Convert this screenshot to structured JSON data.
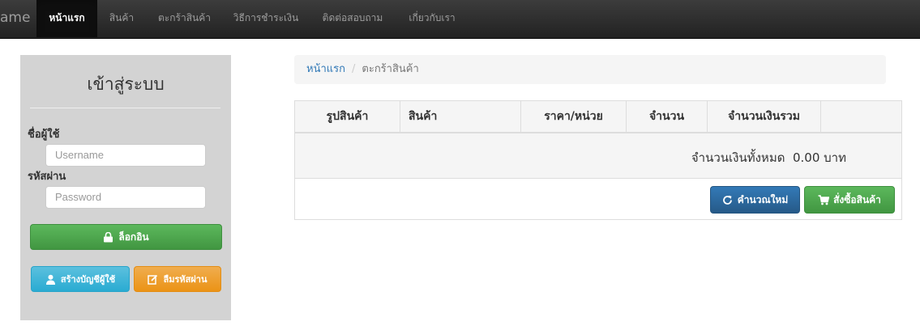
{
  "navbar": {
    "brand": "ame",
    "items": [
      {
        "label": "หน้าแรก",
        "active": true
      },
      {
        "label": "สินค้า",
        "active": false
      },
      {
        "label": "ตะกร้าสินค้า",
        "active": false
      },
      {
        "label": "วิธีการชำระเงิน",
        "active": false
      },
      {
        "label": "ติดต่อสอบถาม",
        "active": false
      },
      {
        "label": "เกี่ยวกับเรา",
        "active": false
      }
    ]
  },
  "login": {
    "title": "เข้าสู่ระบบ",
    "username_label": "ชื่อผู้ใช้",
    "username_placeholder": "Username",
    "password_label": "รหัสผ่าน",
    "password_placeholder": "Password",
    "login_button": "ล็อกอิน",
    "register_button": "สร้างบัญชีผู้ใช้",
    "forgot_button": "ลืมรหัสผ่าน"
  },
  "breadcrumb": {
    "home": "หน้าแรก",
    "current": "ตะกร้าสินค้า"
  },
  "cart": {
    "headers": [
      "รูปสินค้า",
      "สินค้า",
      "ราคา/หน่วย",
      "จำนวน",
      "จำนวนเงินรวม"
    ],
    "total_text": "จำนวนเงินทั้งหมด  0.00 บาท",
    "recalc_button": "คำนวณใหม่",
    "order_button": "สั่งซื้อสินค้า"
  }
}
